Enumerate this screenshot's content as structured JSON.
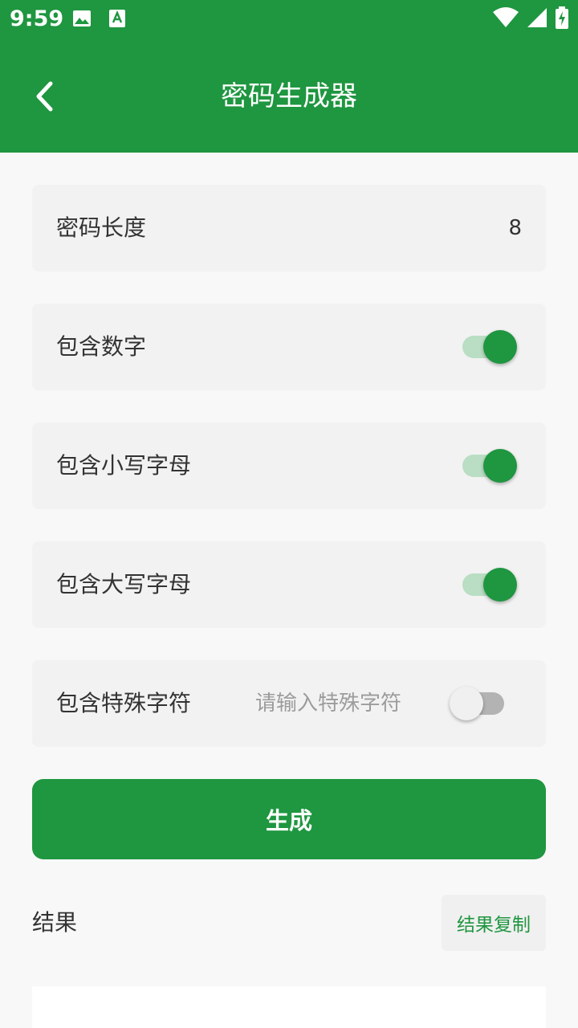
{
  "status_bar": {
    "time": "9:59",
    "left_icons": [
      "image-icon",
      "app-a-icon"
    ],
    "right_icons": [
      "wifi-icon",
      "signal-icon",
      "battery-charging-icon"
    ]
  },
  "header": {
    "title": "密码生成器",
    "back_icon": "chevron-left-icon",
    "background": "#1f9640"
  },
  "options": {
    "length": {
      "label": "密码长度",
      "value": "8"
    },
    "digits": {
      "label": "包含数字",
      "enabled": true
    },
    "lowercase": {
      "label": "包含小写字母",
      "enabled": true
    },
    "uppercase": {
      "label": "包含大写字母",
      "enabled": true
    },
    "special": {
      "label": "包含特殊字符",
      "placeholder": "请输入特殊字符",
      "value": "",
      "enabled": false
    }
  },
  "generate_button": {
    "label": "生成"
  },
  "result": {
    "label": "结果",
    "copy_label": "结果复制",
    "value": ""
  },
  "colors": {
    "accent": "#1f9640",
    "card": "#f2f2f2",
    "page": "#f8f8f8"
  }
}
